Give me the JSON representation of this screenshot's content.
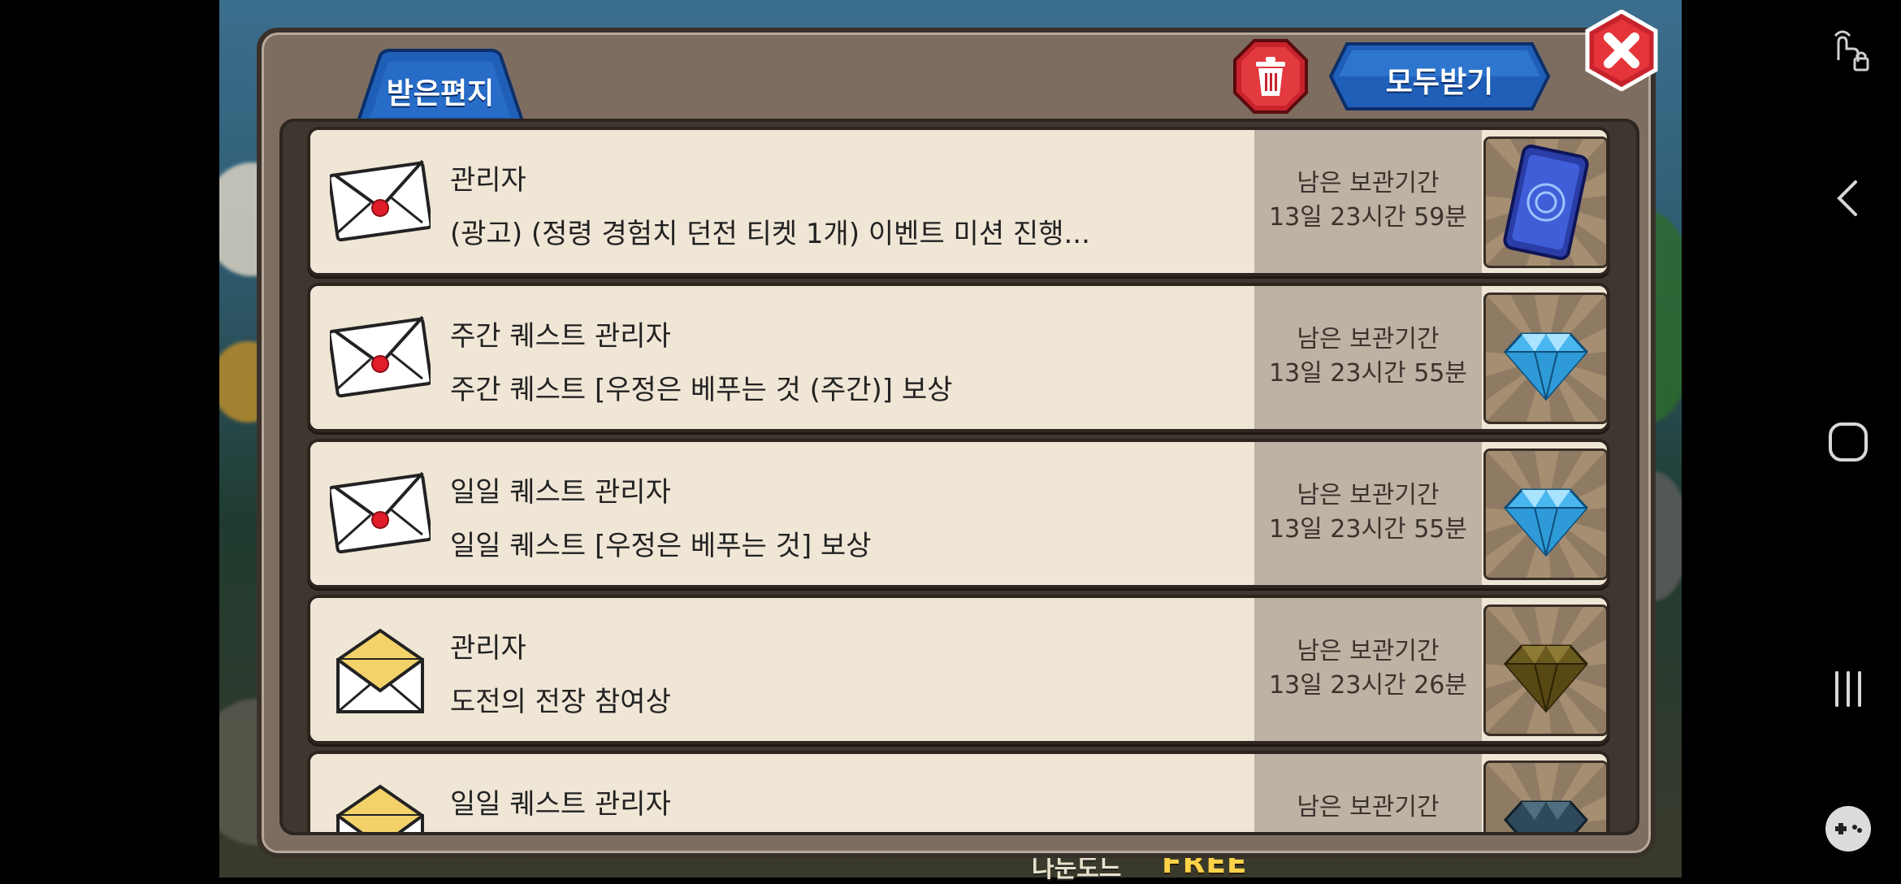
{
  "window": {
    "tab_label": "받은편지",
    "receive_all_label": "모두받기"
  },
  "hud": {
    "share_label": "나눈도느",
    "free_label": "FREE"
  },
  "mails": [
    {
      "sender": "관리자",
      "message": "(광고) (정령 경험치 던전 티켓 1개) 이벤트 미션 진행...",
      "time_label": "남은 보관기간",
      "time_value": "13일 23시간 59분",
      "envelope": "unopened",
      "reward_icon": "ticket-icon"
    },
    {
      "sender": "주간 퀘스트 관리자",
      "message": "주간 퀘스트 [우정은 베푸는 것 (주간)] 보상",
      "time_label": "남은 보관기간",
      "time_value": "13일 23시간 55분",
      "envelope": "unopened",
      "reward_icon": "blue-diamond-icon"
    },
    {
      "sender": "일일 퀘스트 관리자",
      "message": "일일 퀘스트 [우정은 베푸는 것] 보상",
      "time_label": "남은 보관기간",
      "time_value": "13일 23시간 55분",
      "envelope": "unopened",
      "reward_icon": "blue-diamond-icon"
    },
    {
      "sender": "관리자",
      "message": "도전의 전장 참여상",
      "time_label": "남은 보관기간",
      "time_value": "13일 23시간 26분",
      "envelope": "opened",
      "reward_icon": "bronze-diamond-icon"
    },
    {
      "sender": "일일 퀘스트 관리자",
      "message": "",
      "time_label": "남은 보관기간",
      "time_value": "",
      "envelope": "opened",
      "reward_icon": "dark-diamond-icon"
    }
  ],
  "colors": {
    "tab_blue": "#1f5fb8",
    "close_red": "#c8232c",
    "window_brown": "#7d6d60",
    "row_bg": "#efe6d6",
    "time_panel": "#bdb2a3"
  }
}
